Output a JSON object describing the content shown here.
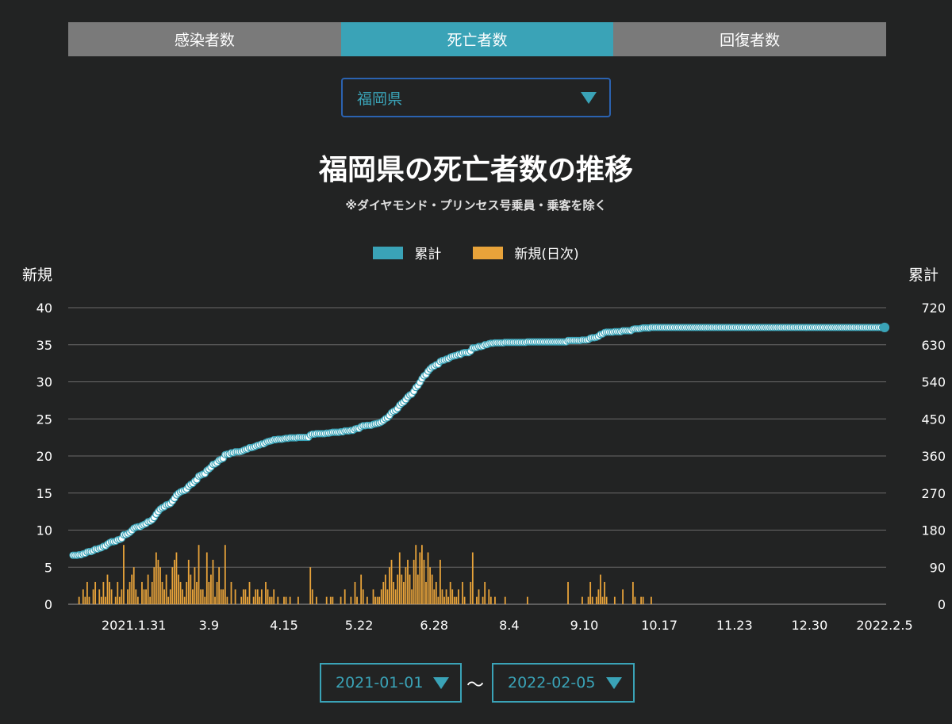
{
  "tabs": [
    {
      "label": "感染者数",
      "active": false
    },
    {
      "label": "死亡者数",
      "active": true
    },
    {
      "label": "回復者数",
      "active": false
    }
  ],
  "prefecture_select": {
    "value": "福岡県"
  },
  "date_range": {
    "start": "2021-01-01",
    "separator": "〜",
    "end": "2022-02-05"
  },
  "colors": {
    "accent": "#3aa3b7",
    "daily": "#e8a33a",
    "cumulative_marker_fill": "#ffffff",
    "tab_inactive": "#7a7a7a",
    "select_border": "#2b62b0"
  },
  "chart_data": {
    "type": "bar",
    "title": "福岡県の死亡者数の推移",
    "subtitle": "※ダイヤモンド・プリンセス号乗員・乗客を除く",
    "y_left_label": "新規",
    "y_right_label": "累計",
    "y_left_ticks": [
      "0",
      "5",
      "10",
      "15",
      "20",
      "25",
      "30",
      "35",
      "40"
    ],
    "y_right_ticks": [
      "0",
      "90",
      "180",
      "270",
      "360",
      "450",
      "540",
      "630",
      "720"
    ],
    "ylim_left": [
      0,
      40
    ],
    "ylim_right": [
      0,
      720
    ],
    "x_tick_labels": [
      "2021.1.31",
      "3.9",
      "4.15",
      "5.22",
      "6.28",
      "8.4",
      "9.10",
      "10.17",
      "11.23",
      "12.30",
      "2022.2.5"
    ],
    "x_range": [
      "2021-01-01",
      "2022-02-05"
    ],
    "grid": true,
    "legend_position": "top",
    "series": [
      {
        "name": "累計",
        "type": "line-markers",
        "start_value": 119,
        "daily_increment_source": "新規(日次)",
        "end_value": 672
      },
      {
        "name": "新規(日次)",
        "type": "bar",
        "start_date": "2021-01-01",
        "values": [
          0,
          0,
          0,
          1,
          0,
          2,
          1,
          3,
          1,
          0,
          2,
          3,
          0,
          2,
          1,
          3,
          1,
          4,
          3,
          2,
          0,
          1,
          3,
          1,
          2,
          8,
          0,
          2,
          3,
          4,
          5,
          2,
          1,
          0,
          3,
          2,
          2,
          4,
          1,
          3,
          5,
          7,
          6,
          5,
          3,
          2,
          4,
          1,
          2,
          5,
          6,
          7,
          4,
          3,
          2,
          1,
          3,
          6,
          4,
          2,
          5,
          3,
          8,
          2,
          2,
          1,
          7,
          3,
          4,
          6,
          1,
          3,
          5,
          2,
          2,
          8,
          1,
          0,
          3,
          0,
          2,
          0,
          0,
          1,
          2,
          2,
          1,
          3,
          0,
          1,
          2,
          2,
          1,
          2,
          0,
          3,
          2,
          1,
          1,
          2,
          0,
          1,
          0,
          0,
          1,
          1,
          0,
          1,
          0,
          0,
          0,
          1,
          0,
          0,
          0,
          0,
          0,
          5,
          2,
          0,
          1,
          0,
          0,
          0,
          0,
          1,
          0,
          1,
          1,
          0,
          0,
          0,
          1,
          0,
          2,
          0,
          0,
          1,
          0,
          3,
          1,
          0,
          4,
          2,
          0,
          1,
          0,
          0,
          2,
          1,
          1,
          1,
          2,
          3,
          4,
          2,
          5,
          6,
          3,
          2,
          4,
          7,
          4,
          3,
          5,
          6,
          4,
          2,
          6,
          8,
          4,
          7,
          8,
          6,
          3,
          7,
          5,
          4,
          2,
          3,
          1,
          6,
          2,
          1,
          2,
          1,
          3,
          2,
          1,
          1,
          2,
          0,
          3,
          1,
          0,
          0,
          3,
          7,
          0,
          1,
          2,
          0,
          1,
          3,
          0,
          2,
          1,
          0,
          1,
          0,
          0,
          0,
          0,
          1,
          0,
          0,
          0,
          0,
          0,
          0,
          0,
          0,
          0,
          0,
          1,
          0,
          0,
          0,
          0,
          0,
          0,
          0,
          0,
          0,
          0,
          0,
          0,
          0,
          0,
          0,
          0,
          0,
          0,
          0,
          3,
          0,
          0,
          0,
          0,
          0,
          0,
          1,
          0,
          0,
          1,
          3,
          1,
          0,
          1,
          2,
          4,
          1,
          3,
          1,
          0,
          0,
          0,
          1,
          0,
          0,
          0,
          2,
          0,
          0,
          0,
          0,
          3,
          1,
          0,
          0,
          1,
          1,
          0,
          0,
          0,
          1,
          0,
          0,
          0,
          0,
          0,
          0,
          0,
          0,
          0,
          0,
          0,
          0,
          0,
          0,
          0,
          0,
          0,
          0,
          0,
          0,
          0,
          0,
          0,
          0,
          0,
          0,
          0,
          0,
          0,
          0,
          0,
          0,
          0,
          0,
          0,
          0,
          0,
          0,
          0,
          0,
          0,
          0,
          0,
          0,
          0,
          0,
          0,
          0,
          0,
          0,
          0,
          0,
          0,
          0,
          0,
          0,
          0,
          0,
          0,
          0,
          0,
          0,
          0,
          0,
          0,
          0,
          0,
          0,
          0,
          0,
          0,
          0,
          0,
          0,
          0,
          0,
          0,
          0,
          0,
          0,
          0,
          0,
          0,
          0,
          0,
          0,
          0,
          0,
          0,
          0,
          0,
          0,
          0,
          0,
          0,
          0,
          0,
          0,
          0,
          0,
          0,
          0,
          0,
          0,
          0,
          0,
          0,
          0,
          0,
          0,
          0,
          0,
          0,
          0,
          0,
          0,
          0,
          0,
          0,
          0,
          0,
          0,
          0,
          0,
          0,
          0,
          0,
          0,
          0,
          0,
          0,
          0,
          0,
          0,
          0,
          0,
          0,
          0,
          0,
          0,
          0,
          0,
          0,
          0,
          0,
          0,
          0,
          0,
          0,
          0,
          0,
          0,
          0,
          0,
          0,
          0,
          0,
          0,
          0,
          0,
          0,
          0,
          0,
          0,
          0,
          0,
          0,
          0,
          0,
          0,
          0,
          0,
          0,
          0,
          0,
          0,
          0,
          0,
          0,
          0,
          0,
          0,
          0,
          0,
          0,
          0,
          0,
          0,
          0,
          0,
          0,
          0,
          0,
          0,
          0,
          0,
          0,
          0,
          0,
          0,
          0,
          0,
          0,
          0,
          0,
          0,
          0,
          0,
          0,
          0,
          0
        ]
      }
    ]
  }
}
